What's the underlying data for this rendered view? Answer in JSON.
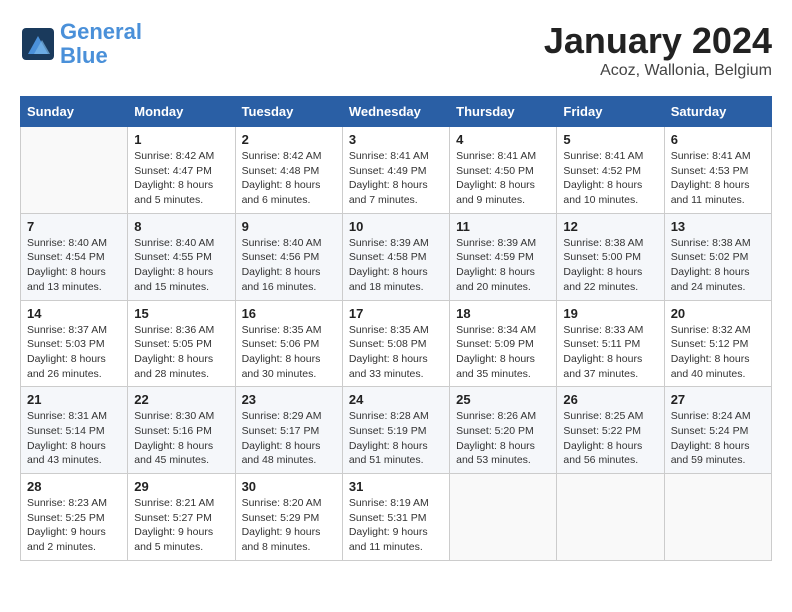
{
  "header": {
    "logo_line1": "General",
    "logo_line2": "Blue",
    "month": "January 2024",
    "location": "Acoz, Wallonia, Belgium"
  },
  "weekdays": [
    "Sunday",
    "Monday",
    "Tuesday",
    "Wednesday",
    "Thursday",
    "Friday",
    "Saturday"
  ],
  "weeks": [
    [
      {
        "day": "",
        "info": ""
      },
      {
        "day": "1",
        "info": "Sunrise: 8:42 AM\nSunset: 4:47 PM\nDaylight: 8 hours\nand 5 minutes."
      },
      {
        "day": "2",
        "info": "Sunrise: 8:42 AM\nSunset: 4:48 PM\nDaylight: 8 hours\nand 6 minutes."
      },
      {
        "day": "3",
        "info": "Sunrise: 8:41 AM\nSunset: 4:49 PM\nDaylight: 8 hours\nand 7 minutes."
      },
      {
        "day": "4",
        "info": "Sunrise: 8:41 AM\nSunset: 4:50 PM\nDaylight: 8 hours\nand 9 minutes."
      },
      {
        "day": "5",
        "info": "Sunrise: 8:41 AM\nSunset: 4:52 PM\nDaylight: 8 hours\nand 10 minutes."
      },
      {
        "day": "6",
        "info": "Sunrise: 8:41 AM\nSunset: 4:53 PM\nDaylight: 8 hours\nand 11 minutes."
      }
    ],
    [
      {
        "day": "7",
        "info": "Sunrise: 8:40 AM\nSunset: 4:54 PM\nDaylight: 8 hours\nand 13 minutes."
      },
      {
        "day": "8",
        "info": "Sunrise: 8:40 AM\nSunset: 4:55 PM\nDaylight: 8 hours\nand 15 minutes."
      },
      {
        "day": "9",
        "info": "Sunrise: 8:40 AM\nSunset: 4:56 PM\nDaylight: 8 hours\nand 16 minutes."
      },
      {
        "day": "10",
        "info": "Sunrise: 8:39 AM\nSunset: 4:58 PM\nDaylight: 8 hours\nand 18 minutes."
      },
      {
        "day": "11",
        "info": "Sunrise: 8:39 AM\nSunset: 4:59 PM\nDaylight: 8 hours\nand 20 minutes."
      },
      {
        "day": "12",
        "info": "Sunrise: 8:38 AM\nSunset: 5:00 PM\nDaylight: 8 hours\nand 22 minutes."
      },
      {
        "day": "13",
        "info": "Sunrise: 8:38 AM\nSunset: 5:02 PM\nDaylight: 8 hours\nand 24 minutes."
      }
    ],
    [
      {
        "day": "14",
        "info": "Sunrise: 8:37 AM\nSunset: 5:03 PM\nDaylight: 8 hours\nand 26 minutes."
      },
      {
        "day": "15",
        "info": "Sunrise: 8:36 AM\nSunset: 5:05 PM\nDaylight: 8 hours\nand 28 minutes."
      },
      {
        "day": "16",
        "info": "Sunrise: 8:35 AM\nSunset: 5:06 PM\nDaylight: 8 hours\nand 30 minutes."
      },
      {
        "day": "17",
        "info": "Sunrise: 8:35 AM\nSunset: 5:08 PM\nDaylight: 8 hours\nand 33 minutes."
      },
      {
        "day": "18",
        "info": "Sunrise: 8:34 AM\nSunset: 5:09 PM\nDaylight: 8 hours\nand 35 minutes."
      },
      {
        "day": "19",
        "info": "Sunrise: 8:33 AM\nSunset: 5:11 PM\nDaylight: 8 hours\nand 37 minutes."
      },
      {
        "day": "20",
        "info": "Sunrise: 8:32 AM\nSunset: 5:12 PM\nDaylight: 8 hours\nand 40 minutes."
      }
    ],
    [
      {
        "day": "21",
        "info": "Sunrise: 8:31 AM\nSunset: 5:14 PM\nDaylight: 8 hours\nand 43 minutes."
      },
      {
        "day": "22",
        "info": "Sunrise: 8:30 AM\nSunset: 5:16 PM\nDaylight: 8 hours\nand 45 minutes."
      },
      {
        "day": "23",
        "info": "Sunrise: 8:29 AM\nSunset: 5:17 PM\nDaylight: 8 hours\nand 48 minutes."
      },
      {
        "day": "24",
        "info": "Sunrise: 8:28 AM\nSunset: 5:19 PM\nDaylight: 8 hours\nand 51 minutes."
      },
      {
        "day": "25",
        "info": "Sunrise: 8:26 AM\nSunset: 5:20 PM\nDaylight: 8 hours\nand 53 minutes."
      },
      {
        "day": "26",
        "info": "Sunrise: 8:25 AM\nSunset: 5:22 PM\nDaylight: 8 hours\nand 56 minutes."
      },
      {
        "day": "27",
        "info": "Sunrise: 8:24 AM\nSunset: 5:24 PM\nDaylight: 8 hours\nand 59 minutes."
      }
    ],
    [
      {
        "day": "28",
        "info": "Sunrise: 8:23 AM\nSunset: 5:25 PM\nDaylight: 9 hours\nand 2 minutes."
      },
      {
        "day": "29",
        "info": "Sunrise: 8:21 AM\nSunset: 5:27 PM\nDaylight: 9 hours\nand 5 minutes."
      },
      {
        "day": "30",
        "info": "Sunrise: 8:20 AM\nSunset: 5:29 PM\nDaylight: 9 hours\nand 8 minutes."
      },
      {
        "day": "31",
        "info": "Sunrise: 8:19 AM\nSunset: 5:31 PM\nDaylight: 9 hours\nand 11 minutes."
      },
      {
        "day": "",
        "info": ""
      },
      {
        "day": "",
        "info": ""
      },
      {
        "day": "",
        "info": ""
      }
    ]
  ]
}
